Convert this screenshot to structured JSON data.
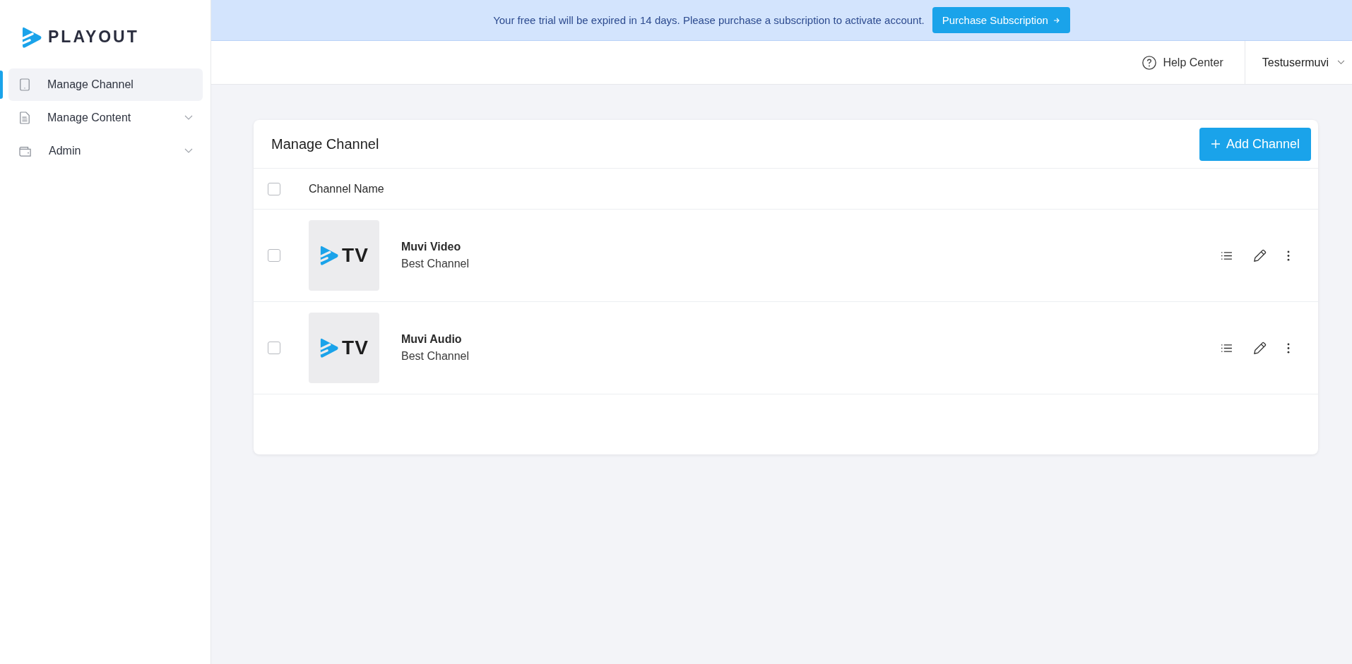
{
  "sidebar": {
    "logo": "PLAYOUT",
    "items": [
      {
        "label": "Manage Channel",
        "kind": "tablet",
        "selected": true,
        "expandable": false
      },
      {
        "label": "Manage Content",
        "kind": "document",
        "selected": false,
        "expandable": true
      },
      {
        "label": "Admin",
        "kind": "wallet",
        "selected": false,
        "expandable": true
      }
    ]
  },
  "banner": {
    "message": "Your free trial will be expired in 14 days. Please purchase a subscription to activate account.",
    "button": "Purchase Subscription"
  },
  "header": {
    "help": "Help Center",
    "user": "Testusermuvi"
  },
  "card": {
    "title": "Manage Channel",
    "add_button": "Add Channel",
    "table": {
      "select_all_checked": false,
      "columns": [
        "Channel Name"
      ],
      "rows": [
        {
          "checked": false,
          "thumbnail": "TV",
          "name": "Muvi Video",
          "description": "Best Channel"
        },
        {
          "checked": false,
          "thumbnail": "TV",
          "name": "Muvi Audio",
          "description": "Best Channel"
        }
      ]
    }
  }
}
